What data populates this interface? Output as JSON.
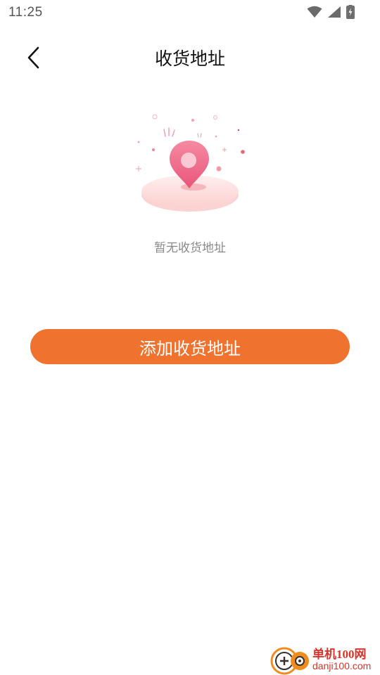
{
  "status_bar": {
    "time": "11:25",
    "icons": [
      "wifi-icon",
      "signal-icon",
      "battery-charging-icon"
    ]
  },
  "header": {
    "back_icon": "chevron-left-icon",
    "title": "收货地址"
  },
  "empty_state": {
    "illustration": "location-pin-icon",
    "message": "暂无收货地址"
  },
  "actions": {
    "add_address_label": "添加收货地址"
  },
  "watermark": {
    "line1": "单机100网",
    "line2": "danji100.com"
  },
  "colors": {
    "accent": "#ef722e",
    "pin": "#f06d8c",
    "text_secondary": "#8a8a8a"
  }
}
